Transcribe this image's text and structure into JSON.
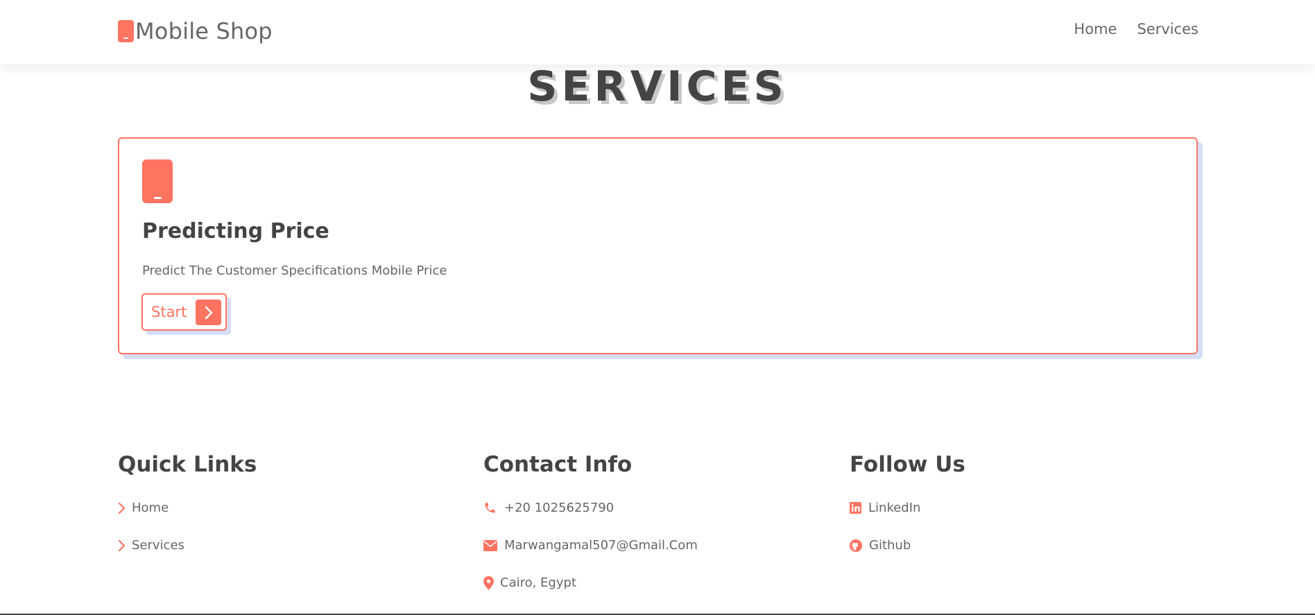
{
  "header": {
    "logo_text": "Mobile Shop",
    "nav": [
      {
        "label": "Home"
      },
      {
        "label": "Services"
      }
    ]
  },
  "services": {
    "title": "SERVICES",
    "card": {
      "icon": "mobile-phone-icon",
      "title": "Predicting Price",
      "description": "Predict The Customer Specifications Mobile Price",
      "button_label": "Start"
    }
  },
  "footer": {
    "quick_links": {
      "title": "Quick Links",
      "items": [
        {
          "label": "Home",
          "icon": "chevron-right-icon"
        },
        {
          "label": "Services",
          "icon": "chevron-right-icon"
        }
      ]
    },
    "contact_info": {
      "title": "Contact Info",
      "items": [
        {
          "label": "+20 1025625790",
          "icon": "phone-icon"
        },
        {
          "label": "Marwangamal507@Gmail.Com",
          "icon": "envelope-icon"
        },
        {
          "label": "Cairo, Egypt",
          "icon": "map-pin-icon"
        }
      ]
    },
    "follow_us": {
      "title": "Follow Us",
      "items": [
        {
          "label": "LinkedIn",
          "icon": "linkedin-icon"
        },
        {
          "label": "Github",
          "icon": "github-icon"
        }
      ]
    }
  },
  "colors": {
    "accent": "#ff7360",
    "heading": "#444444",
    "text": "#666666",
    "card_shadow": "#d4def5"
  }
}
